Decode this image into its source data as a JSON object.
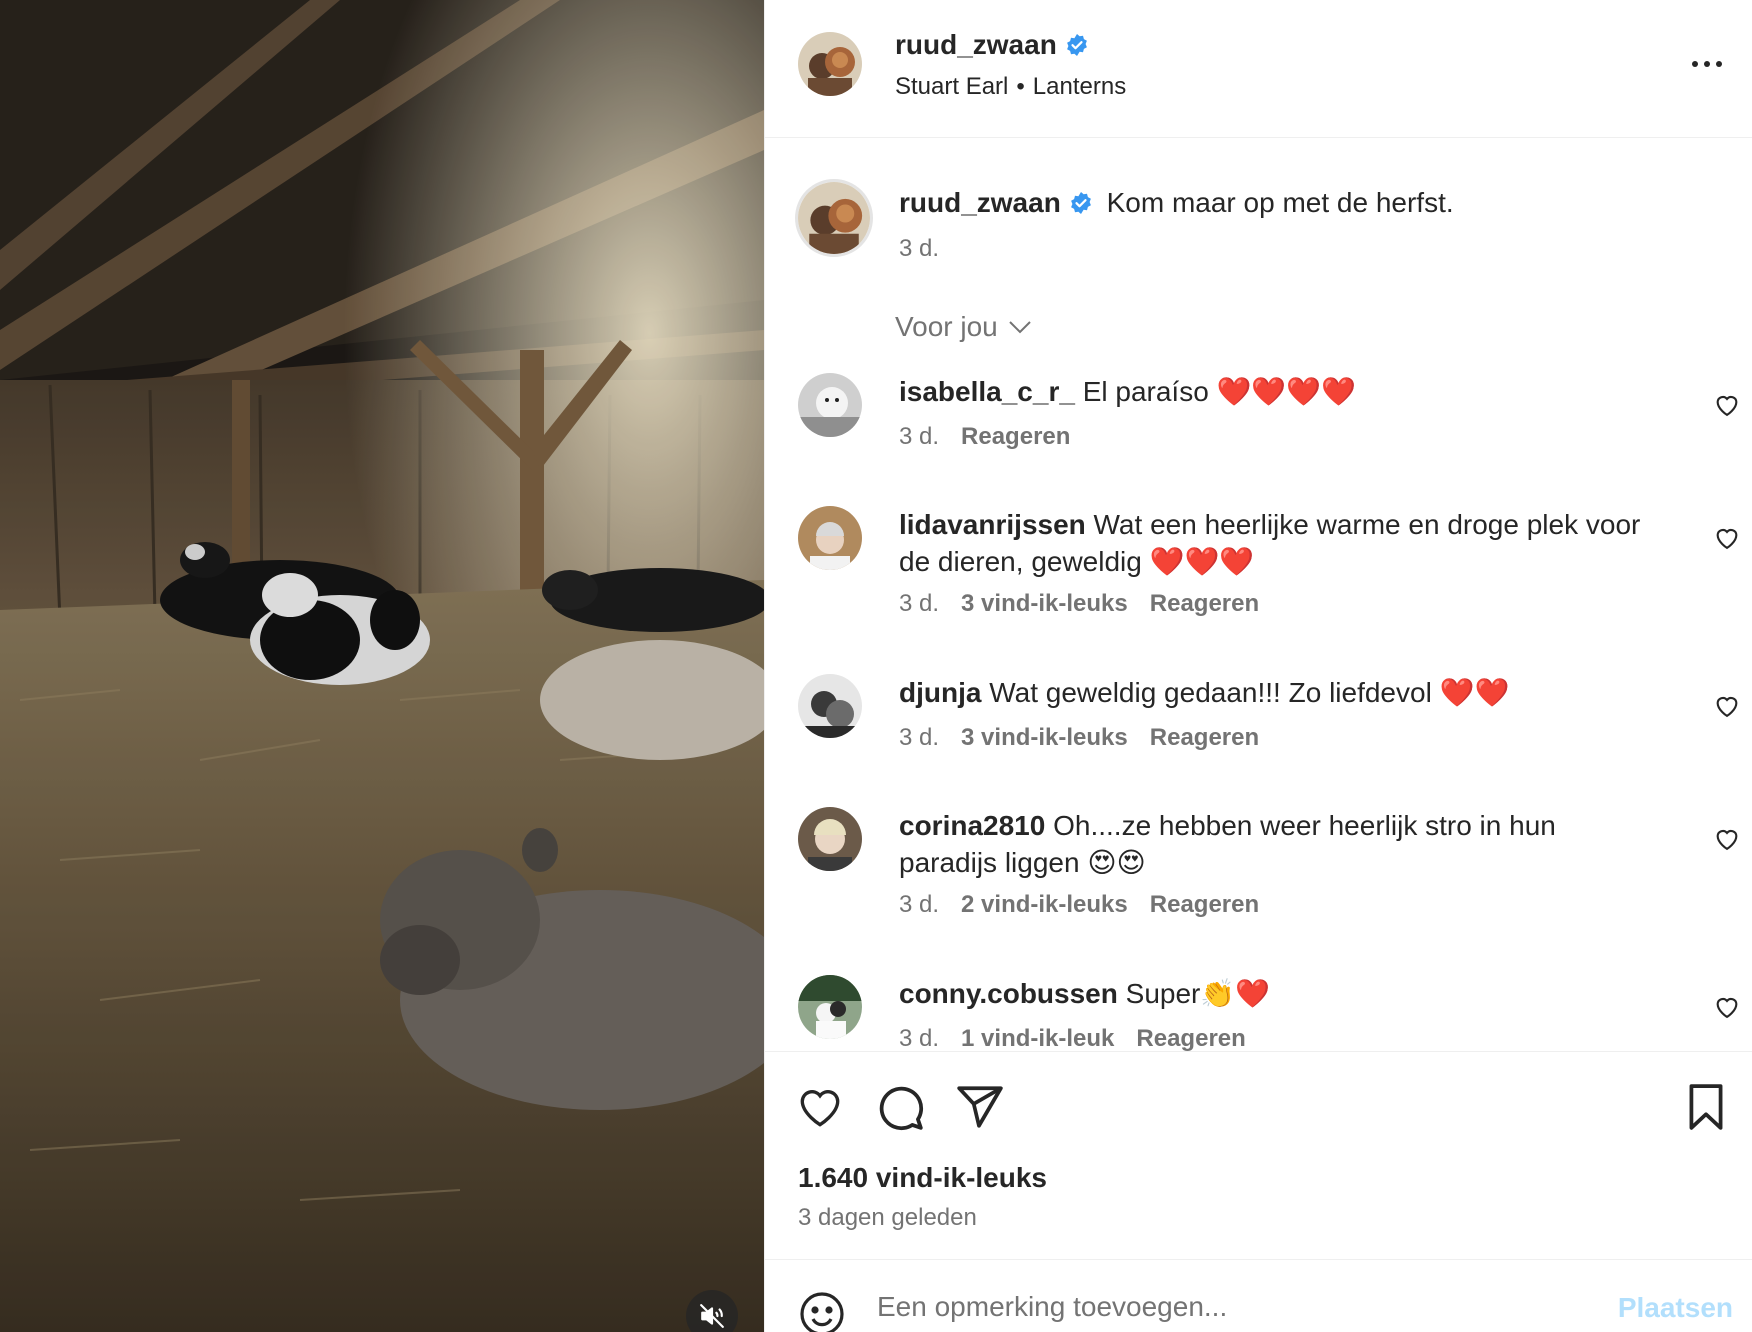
{
  "colors": {
    "verified": "#3897f0",
    "heart_red": "#e0243a",
    "link_disabled": "#b2dffc",
    "secondary_text": "#737373"
  },
  "media": {
    "icon": "speaker-muted-icon"
  },
  "header": {
    "username": "ruud_zwaan",
    "music_artist": "Stuart Earl",
    "separator": "•",
    "music_title": "Lanterns",
    "more_icon": "more-horizontal-icon"
  },
  "caption": {
    "username": "ruud_zwaan",
    "text": "Kom maar op met de herfst.",
    "time": "3 d."
  },
  "sort": {
    "label": "Voor jou"
  },
  "comments": [
    {
      "username": "isabella_c_r_",
      "text": "El paraíso",
      "emoji": "❤️❤️❤️❤️",
      "time": "3 d.",
      "likes": "",
      "reply": "Reageren"
    },
    {
      "username": "lidavanrijssen",
      "text": "Wat een heerlijke warme en droge plek voor de dieren, geweldig",
      "emoji": "❤️❤️❤️",
      "time": "3 d.",
      "likes": "3 vind-ik-leuks",
      "reply": "Reageren"
    },
    {
      "username": "djunja",
      "text": "Wat geweldig gedaan!!! Zo liefdevol",
      "emoji": "❤️❤️",
      "time": "3 d.",
      "likes": "3 vind-ik-leuks",
      "reply": "Reageren"
    },
    {
      "username": "corina2810",
      "text": "Oh....ze hebben weer heerlijk stro in hun paradijs liggen",
      "emoji": "😍😍",
      "time": "3 d.",
      "likes": "2 vind-ik-leuks",
      "reply": "Reageren"
    },
    {
      "username": "conny.cobussen",
      "text": "Super",
      "emoji": "👏❤️",
      "time": "3 d.",
      "likes": "1 vind-ik-leuk",
      "reply": "Reageren"
    }
  ],
  "actions": {
    "likes": "1.640 vind-ik-leuks",
    "posted": "3 dagen geleden"
  },
  "add_comment": {
    "placeholder": "Een opmerking toevoegen...",
    "post_label": "Plaatsen"
  }
}
